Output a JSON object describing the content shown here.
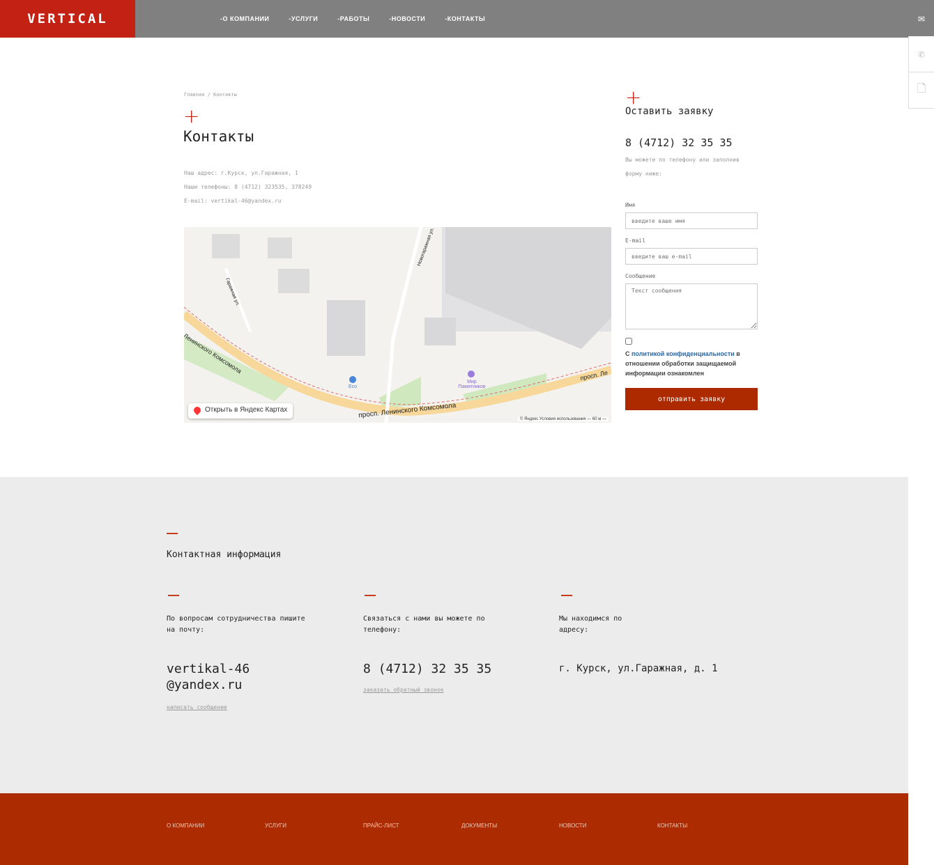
{
  "header": {
    "logo": "VERTICAL",
    "nav": [
      "-О КОМПАНИИ",
      "-УСЛУГИ",
      "-РАБОТЫ",
      "-НОВОСТИ",
      "-КОНТАКТЫ"
    ]
  },
  "side": {
    "icons": [
      "mail-icon",
      "phone-icon",
      "document-icon"
    ]
  },
  "page": {
    "breadcrumb": "Главная / Контакты",
    "title": "Контакты",
    "address": "Наш адрес: г.Курск, ул.Гаражная, 1",
    "phones": "Наши телефоны: 8 (4712) 323535, 378249",
    "email": "E-mail: vertikal-46@yandex.ru"
  },
  "map": {
    "open_label": "Открыть в Яндекс Картах",
    "street1": "просп. Ленинского Комсомола",
    "street2": "Ленинского Комсомола",
    "street3": "Гаражная ул.",
    "street4": "Новогаражная ул.",
    "poi": "Мир Памятников",
    "poi2": "Eco",
    "street5": "просп. Ле",
    "copyright": "© Яндекс   Условия использования",
    "scale": "60 м"
  },
  "form": {
    "title": "Оставить заявку",
    "phone": "8 (4712) 32 35 35",
    "note": "Вы можете по телефону или заполнив форму ниже:",
    "name_label": "Имя",
    "name_placeholder": "введите ваше имя",
    "email_label": "E-mail",
    "email_placeholder": "введите ваш e-mail",
    "message_label": "Сообщение",
    "message_placeholder": "Текст сообщения",
    "policy_prefix": "С ",
    "policy_link": "политикой конфиденциальности",
    "policy_suffix": " в отношении обработки защищаемой информации ознакомлен",
    "submit": "отправить заявку"
  },
  "contact": {
    "title": "Контактная информация",
    "cols": [
      {
        "text": "По вопросам сотрудничества пишите на почту:",
        "value": "vertikal-46@yandex.ru",
        "link": "написать сообщение"
      },
      {
        "text": "Связаться с нами вы можете по телефону:",
        "value": "8 (4712) 32 35 35",
        "link": "заказать обратный звонок"
      },
      {
        "text": "Мы находимся по адресу:",
        "value": "г. Курск, ул.Гаражная, д. 1"
      }
    ]
  },
  "footer": [
    "О КОМПАНИИ",
    "УСЛУГИ",
    "ПРАЙС-ЛИСТ",
    "ДОКУМЕНТЫ",
    "НОВОСТИ",
    "КОНТАКТЫ"
  ],
  "colors": {
    "brand": "#c32114",
    "button": "#ad2a00",
    "footer": "#ac2b00"
  }
}
